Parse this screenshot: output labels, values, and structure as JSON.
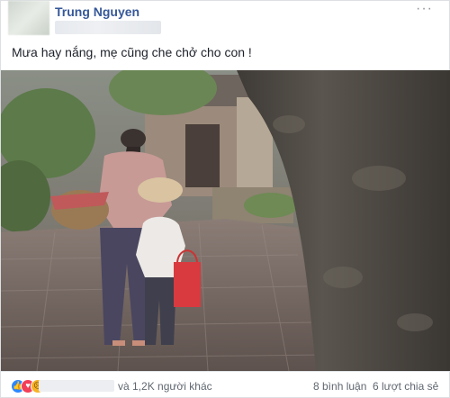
{
  "post": {
    "author": "Trung Nguyen",
    "more_glyph": "···",
    "text": "Mưa hay nắng, mẹ cũng che chở cho con !"
  },
  "reactions": {
    "icons": [
      "like-icon",
      "love-icon",
      "sad-icon"
    ],
    "others_text": "và 1,2K người khác",
    "comments_text": "8 bình luận",
    "shares_text": "6 lượt chia sẻ"
  },
  "colors": {
    "author": "#365899",
    "like": "#2d88ff",
    "love": "#f33e58",
    "sad": "#f7b125",
    "meta_text": "#606770"
  }
}
